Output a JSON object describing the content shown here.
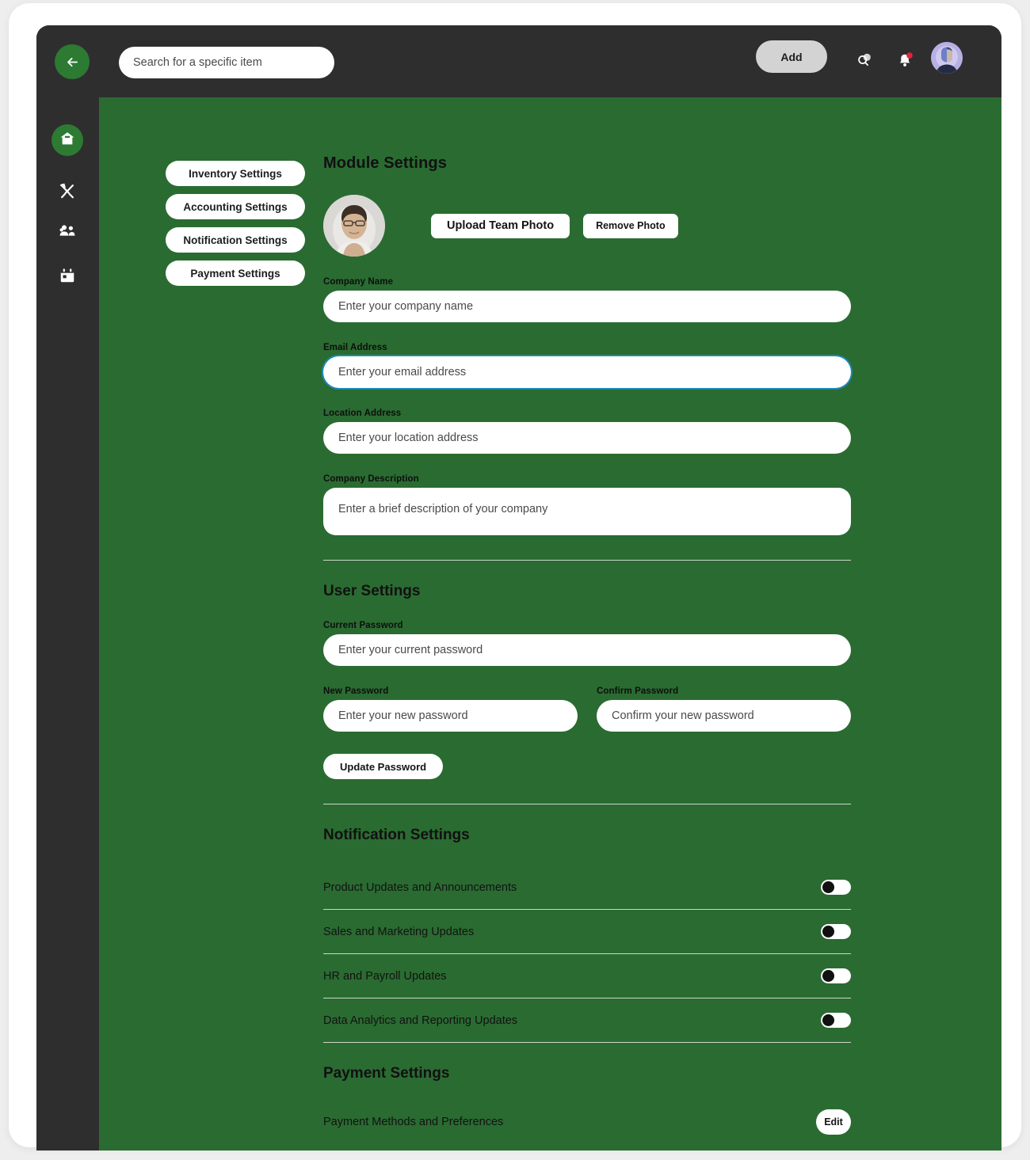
{
  "topbar": {
    "back_icon": "arrow-left-icon",
    "search_placeholder": "Search for a specific item",
    "search_value": "",
    "add_label": "Add",
    "search_icon": "search-icon",
    "bell_icon": "notification-bell-icon",
    "bell_badge": true,
    "avatar": "user-avatar"
  },
  "rail": {
    "items": [
      {
        "name": "home",
        "icon": "home-icon",
        "active": true
      },
      {
        "name": "tools",
        "icon": "tools-icon",
        "active": false
      },
      {
        "name": "team",
        "icon": "people-group-icon",
        "active": false
      },
      {
        "name": "calendar",
        "icon": "calendar-icon",
        "active": false
      }
    ]
  },
  "tabs": [
    {
      "label": "Inventory Settings"
    },
    {
      "label": "Accounting Settings"
    },
    {
      "label": "Notification Settings"
    },
    {
      "label": "Payment Settings"
    }
  ],
  "module_settings": {
    "title": "Module Settings",
    "upload_label": "Upload Team Photo",
    "remove_label": "Remove Photo",
    "fields": {
      "company_name": {
        "label": "Company Name",
        "placeholder": "Enter your company name",
        "value": ""
      },
      "email_address": {
        "label": "Email Address",
        "placeholder": "Enter your email address",
        "value": "",
        "focused": true
      },
      "location": {
        "label": "Location Address",
        "placeholder": "Enter your location address",
        "value": ""
      },
      "description": {
        "label": "Company Description",
        "placeholder": "Enter a brief description of your company",
        "value": ""
      }
    }
  },
  "user_settings": {
    "title": "User Settings",
    "current_password": {
      "label": "Current Password",
      "placeholder": "Enter your current password",
      "value": ""
    },
    "new_password": {
      "label": "New Password",
      "placeholder": "Enter your new password",
      "value": ""
    },
    "confirm_password": {
      "label": "Confirm Password",
      "placeholder": "Confirm your new password",
      "value": ""
    },
    "update_label": "Update Password"
  },
  "notification_settings": {
    "title": "Notification Settings",
    "rows": [
      {
        "label": "Product Updates and Announcements",
        "enabled": false
      },
      {
        "label": "Sales and Marketing Updates",
        "enabled": false
      },
      {
        "label": "HR and Payroll Updates",
        "enabled": false
      },
      {
        "label": "Data Analytics and Reporting Updates",
        "enabled": false
      }
    ]
  },
  "payment_settings": {
    "title": "Payment Settings",
    "row_label": "Payment Methods and Preferences",
    "edit_label": "Edit"
  },
  "colors": {
    "shell_dark": "#2e2e2e",
    "content_green": "#2a6b31",
    "accent_green": "#2d7a33",
    "focus_blue": "#1e88b8",
    "badge_red": "#e8243a",
    "page_bg": "#eeeeee"
  }
}
